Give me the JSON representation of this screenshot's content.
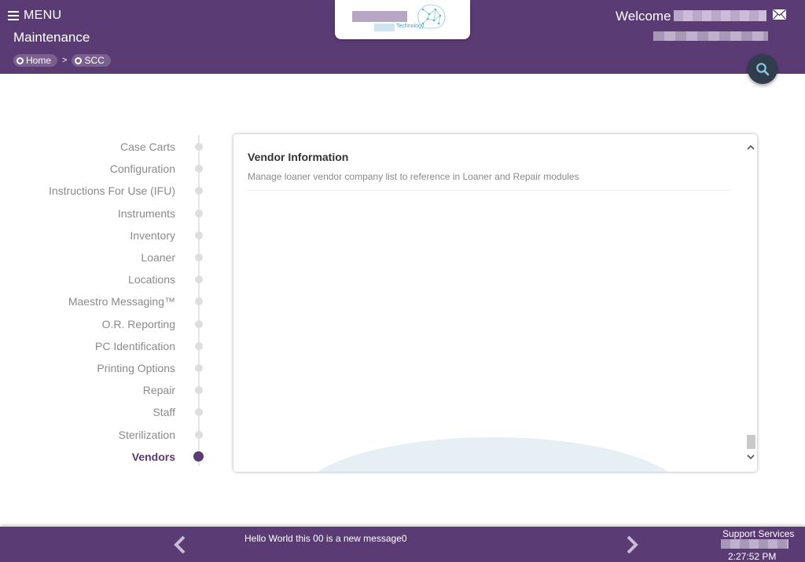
{
  "header": {
    "menu_label": "MENU",
    "page_title": "Maintenance",
    "breadcrumb": [
      {
        "label": "Home"
      },
      {
        "label": "SCC"
      }
    ],
    "breadcrumb_separator": ">",
    "logo_text": "Technology",
    "welcome": "Welcome"
  },
  "nav": {
    "items": [
      {
        "label": "Case Carts"
      },
      {
        "label": "Configuration"
      },
      {
        "label": "Instructions For Use (IFU)"
      },
      {
        "label": "Instruments"
      },
      {
        "label": "Inventory"
      },
      {
        "label": "Loaner"
      },
      {
        "label": "Locations"
      },
      {
        "label": "Maestro Messaging™"
      },
      {
        "label": "O.R. Reporting"
      },
      {
        "label": "PC Identification"
      },
      {
        "label": "Printing Options"
      },
      {
        "label": "Repair"
      },
      {
        "label": "Staff"
      },
      {
        "label": "Sterilization"
      },
      {
        "label": "Vendors"
      }
    ],
    "active_index": 14
  },
  "panel": {
    "title": "Vendor Information",
    "description": "Manage loaner vendor company list to reference in Loaner and Repair modules"
  },
  "footer": {
    "message": "Hello World this 00 is a new message0",
    "support_label": "Support Services",
    "time": "2:27:52 PM"
  },
  "colors": {
    "brand": "#5b3b73",
    "search_button": "#2f3d4c"
  }
}
